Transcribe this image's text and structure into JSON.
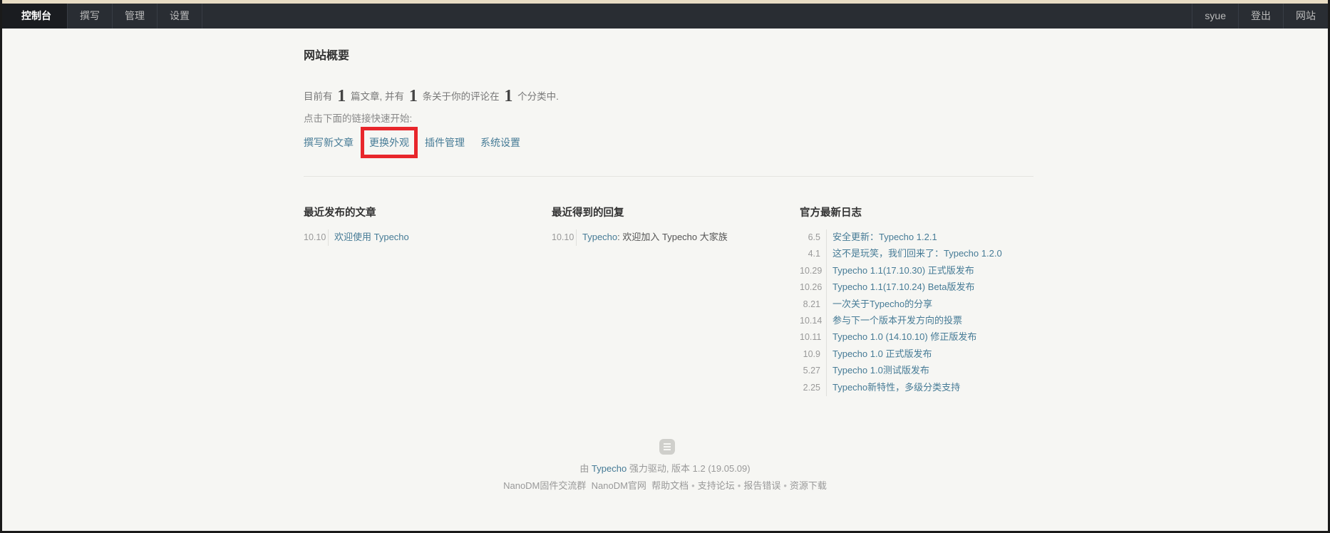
{
  "nav": {
    "left": [
      "控制台",
      "撰写",
      "管理",
      "设置"
    ],
    "right": [
      "syue",
      "登出",
      "网站"
    ]
  },
  "overview": {
    "title": "网站概要",
    "prefix": "目前有",
    "posts_count": "1",
    "posts_label": "篇文章, 并有",
    "comments_count": "1",
    "comments_label": "条关于你的评论在",
    "categories_count": "1",
    "categories_label": "个分类中.",
    "hint": "点击下面的链接快速开始:"
  },
  "quick_links": [
    "撰写新文章",
    "更换外观",
    "插件管理",
    "系统设置"
  ],
  "recent_posts": {
    "title": "最近发布的文章",
    "items": [
      {
        "date": "10.10",
        "text": "欢迎使用 Typecho"
      }
    ]
  },
  "recent_comments": {
    "title": "最近得到的回复",
    "items": [
      {
        "date": "10.10",
        "author": "Typecho",
        "text": ": 欢迎加入 Typecho 大家族"
      }
    ]
  },
  "official_news": {
    "title": "官方最新日志",
    "items": [
      {
        "date": "6.5",
        "text": "安全更新：Typecho 1.2.1"
      },
      {
        "date": "4.1",
        "text": "这不是玩笑，我们回来了：Typecho 1.2.0"
      },
      {
        "date": "10.29",
        "text": "Typecho 1.1(17.10.30) 正式版发布"
      },
      {
        "date": "10.26",
        "text": "Typecho 1.1(17.10.24) Beta版发布"
      },
      {
        "date": "8.21",
        "text": "一次关于Typecho的分享"
      },
      {
        "date": "10.14",
        "text": "参与下一个版本开发方向的投票"
      },
      {
        "date": "10.11",
        "text": "Typecho 1.0 (14.10.10) 修正版发布"
      },
      {
        "date": "10.9",
        "text": "Typecho 1.0 正式版发布"
      },
      {
        "date": "5.27",
        "text": "Typecho 1.0测试版发布"
      },
      {
        "date": "2.25",
        "text": "Typecho新特性，多级分类支持"
      }
    ]
  },
  "footer": {
    "powered_prefix": "由",
    "powered_link": "Typecho",
    "powered_suffix": "强力驱动, 版本 1.2 (19.05.09)",
    "links": [
      "NanoDM固件交流群",
      "NanoDM官网",
      "帮助文档",
      "支持论坛",
      "报告错误",
      "资源下载"
    ]
  },
  "colors": {
    "accent": "#467b96",
    "highlight_box": "#e8262b",
    "nav_bg": "#292d33"
  }
}
